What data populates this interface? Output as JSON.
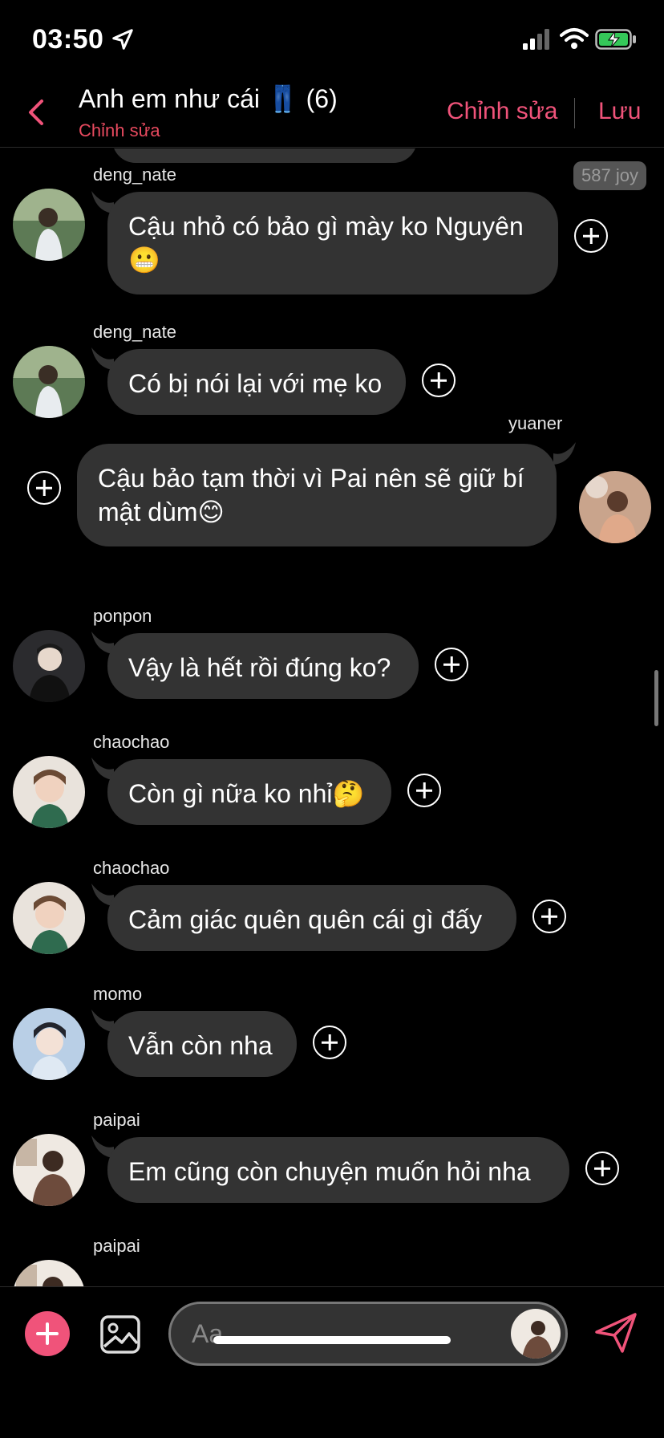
{
  "status": {
    "time": "03:50"
  },
  "header": {
    "title": "Anh em như cái 👖 (6)",
    "subtitle": "Chỉnh sửa",
    "edit_label": "Chỉnh sửa",
    "save_label": "Lưu"
  },
  "chat": {
    "joy": "587 joy",
    "messages": [
      {
        "user": "deng_nate",
        "text": "Cậu nhỏ có bảo gì mày ko Nguyên 😬"
      },
      {
        "user": "deng_nate",
        "text": "Có bị nói lại với mẹ ko"
      },
      {
        "user": "yuaner",
        "text": "Cậu bảo tạm thời vì Pai nên sẽ giữ bí mật dùm😊"
      },
      {
        "user": "ponpon",
        "text": "Vậy là hết rồi đúng ko?"
      },
      {
        "user": "chaochao",
        "text": "Còn gì nữa ko nhỉ🤔"
      },
      {
        "user": "chaochao",
        "text": "Cảm giác quên quên cái gì đấy"
      },
      {
        "user": "momo",
        "text": "Vẫn còn nha"
      },
      {
        "user": "paipai",
        "text": "Em cũng còn chuyện muốn hỏi nha"
      },
      {
        "user": "paipai",
        "text": ""
      }
    ]
  },
  "composer": {
    "placeholder": "Aa"
  },
  "colors": {
    "accent": "#f0537a",
    "bubble": "#333333",
    "background": "#000000"
  },
  "icons": [
    "location-arrow-icon",
    "signal-icon",
    "wifi-icon",
    "battery-charging-icon",
    "back-chevron-icon",
    "plus-circle-icon",
    "add-icon",
    "image-icon",
    "send-icon"
  ]
}
